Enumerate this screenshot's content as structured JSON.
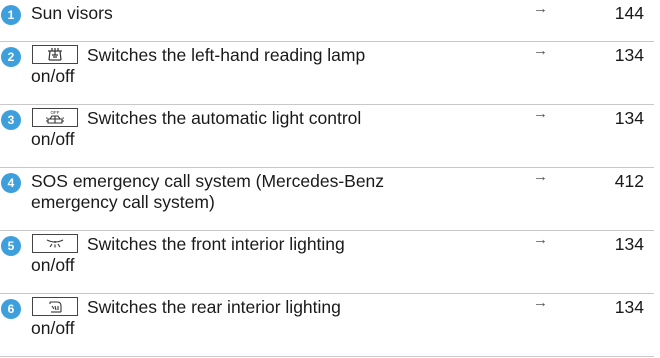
{
  "rows": [
    {
      "number": "1",
      "icon": null,
      "lines": [
        "Sun visors"
      ],
      "arrow": "→",
      "page": "144"
    },
    {
      "number": "2",
      "icon": "reading-lamp-left-icon",
      "lines": [
        "Switches the left-hand reading lamp",
        "on/off"
      ],
      "arrow": "→",
      "page": "134"
    },
    {
      "number": "3",
      "icon": "automatic-light-control-off-icon",
      "icon_text": "OFF",
      "lines": [
        "Switches the automatic light control",
        "on/off"
      ],
      "arrow": "→",
      "page": "134"
    },
    {
      "number": "4",
      "icon": null,
      "lines": [
        "SOS emergency call system (Mercedes-Benz",
        "emergency call system)"
      ],
      "arrow": "→",
      "page": "412"
    },
    {
      "number": "5",
      "icon": "front-interior-lighting-icon",
      "lines": [
        "Switches the front interior lighting",
        "on/off"
      ],
      "arrow": "→",
      "page": "134"
    },
    {
      "number": "6",
      "icon": "rear-interior-lighting-icon",
      "lines": [
        "Switches the rear interior lighting",
        "on/off"
      ],
      "arrow": "→",
      "page": "134"
    }
  ],
  "colors": {
    "badge": "#3da0dc",
    "divider": "#c8c8c8",
    "text": "#1a1a1a"
  }
}
